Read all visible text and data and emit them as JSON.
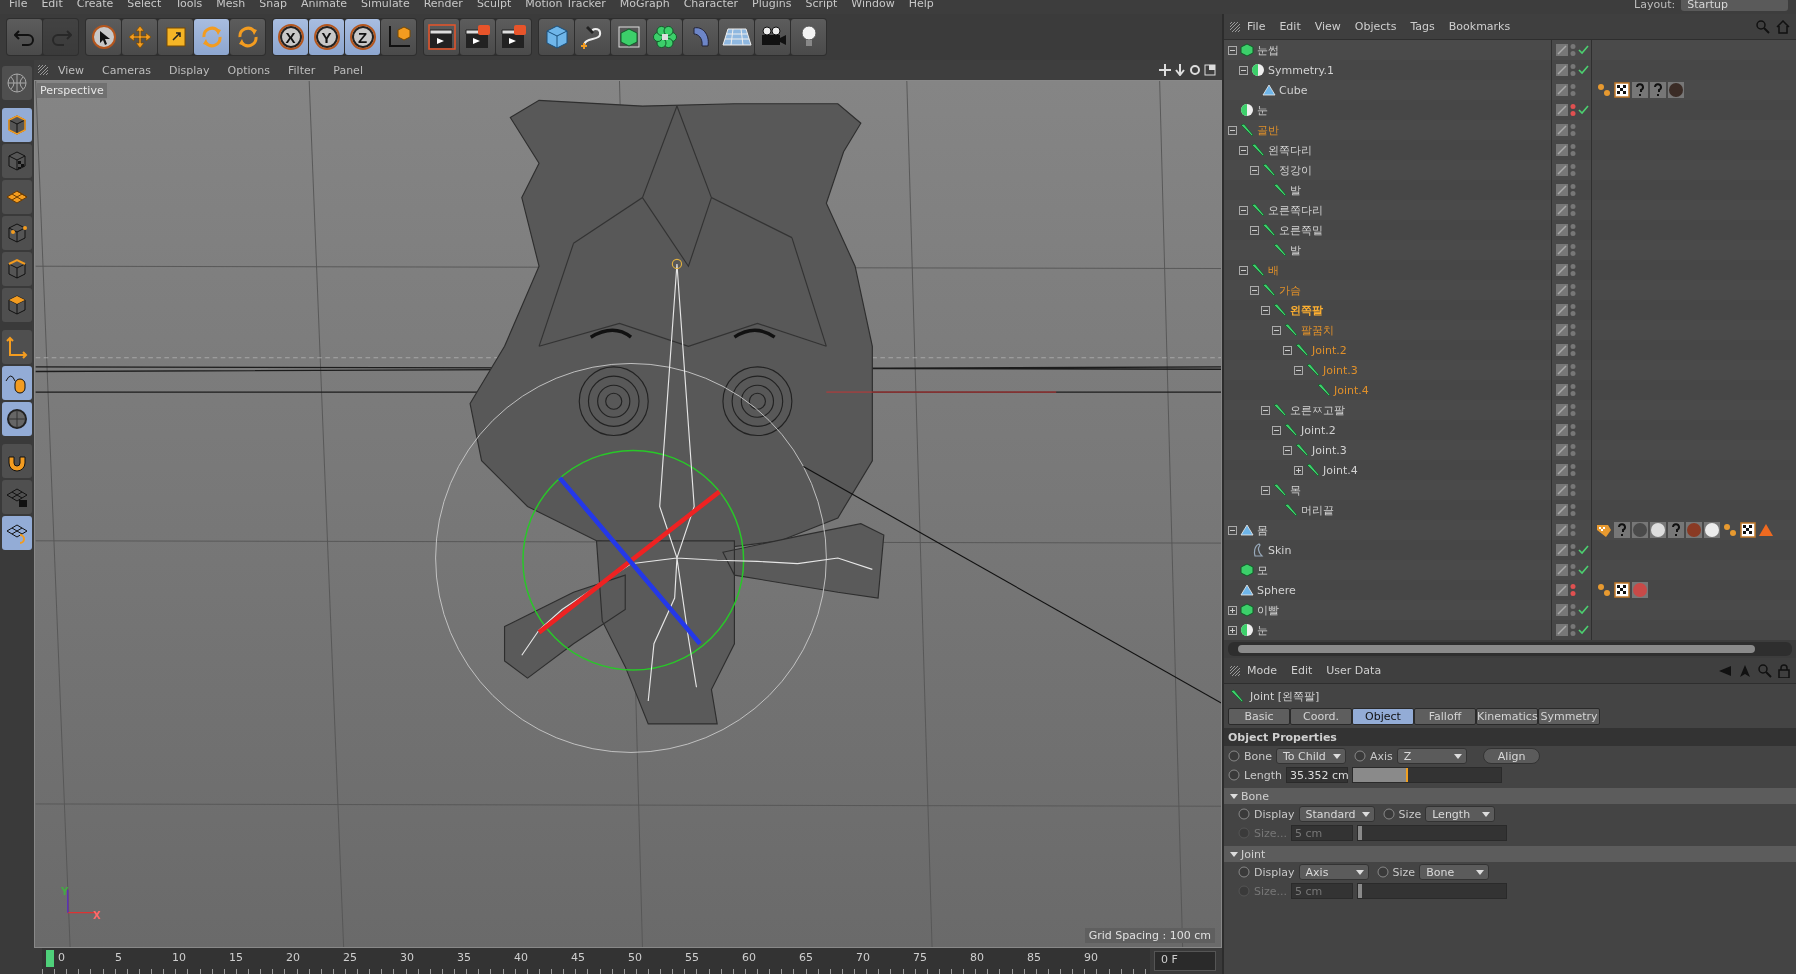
{
  "menu": [
    "File",
    "Edit",
    "Create",
    "Select",
    "Tools",
    "Mesh",
    "Snap",
    "Animate",
    "Simulate",
    "Render",
    "Sculpt",
    "Motion Tracker",
    "MoGraph",
    "Character",
    "Plugins",
    "Script",
    "Window",
    "Help"
  ],
  "layout": {
    "label": "Layout:",
    "value": "Startup"
  },
  "toolbar": [
    [
      {
        "kind": "undo",
        "selected": false,
        "disabled": false
      },
      {
        "kind": "redo",
        "selected": false,
        "disabled": true
      }
    ],
    [
      {
        "kind": "select",
        "selected": false
      },
      {
        "kind": "move",
        "selected": false
      },
      {
        "kind": "scale",
        "selected": false
      },
      {
        "kind": "rotate",
        "selected": true
      },
      {
        "kind": "recent",
        "selected": false
      }
    ],
    [
      {
        "kind": "axis",
        "label": "X",
        "selected": true
      },
      {
        "kind": "axis",
        "label": "Y",
        "selected": true
      },
      {
        "kind": "axis",
        "label": "Z",
        "selected": true
      },
      {
        "kind": "coords",
        "selected": false
      }
    ],
    [
      {
        "kind": "render-view",
        "selected": false
      },
      {
        "kind": "render-picture",
        "selected": false
      },
      {
        "kind": "render-settings",
        "selected": false
      }
    ],
    [
      {
        "kind": "cube",
        "selected": false
      },
      {
        "kind": "pen",
        "selected": false
      },
      {
        "kind": "subdiv",
        "selected": false
      },
      {
        "kind": "array",
        "selected": false
      },
      {
        "kind": "deformer",
        "selected": false
      },
      {
        "kind": "floor",
        "selected": false
      },
      {
        "kind": "camera",
        "selected": false
      },
      {
        "kind": "light",
        "selected": false
      }
    ]
  ],
  "side_tools": [
    {
      "kind": "make-editable",
      "selected": false
    },
    {
      "kind": "model",
      "selected": true
    },
    {
      "kind": "texture",
      "selected": false
    },
    {
      "kind": "workplane",
      "selected": false
    },
    {
      "kind": "points",
      "selected": false
    },
    {
      "kind": "edges",
      "selected": false
    },
    {
      "kind": "polygons",
      "selected": false
    },
    {
      "kind": "axis",
      "selected": false
    },
    {
      "kind": "tweak",
      "selected": true
    },
    {
      "kind": "solo",
      "selected": true
    },
    {
      "kind": "snap",
      "selected": false
    },
    {
      "kind": "lock",
      "selected": false
    },
    {
      "kind": "align",
      "selected": true
    }
  ],
  "viewport": {
    "menu": [
      "View",
      "Cameras",
      "Display",
      "Options",
      "Filter",
      "Panel"
    ],
    "camera": "Perspective",
    "grid_spacing": "Grid Spacing : 100 cm",
    "axis_y": "Y",
    "axis_x": "X"
  },
  "timeline": {
    "ticks": [
      "0",
      "5",
      "10",
      "15",
      "20",
      "25",
      "30",
      "35",
      "40",
      "45",
      "50",
      "55",
      "60",
      "65",
      "70",
      "75",
      "80",
      "85",
      "90"
    ],
    "frame": "0 F"
  },
  "object_manager": {
    "menu": [
      "File",
      "Edit",
      "View",
      "Objects",
      "Tags",
      "Bookmarks"
    ],
    "objects": [
      {
        "name": "눈썹",
        "kind": "null",
        "selected": false,
        "expanded": true,
        "enabled": true,
        "children": [
          {
            "name": "Symmetry.1",
            "kind": "symmetry",
            "selected": false,
            "expanded": true,
            "enabled": true,
            "children": [
              {
                "name": "Cube",
                "kind": "polygon",
                "selected": false,
                "tags": [
                  {
                    "kind": "phong"
                  },
                  {
                    "kind": "checker"
                  },
                  {
                    "kind": "unknown"
                  },
                  {
                    "kind": "unknown"
                  },
                  {
                    "kind": "material",
                    "color": "#3b2c26"
                  }
                ]
              }
            ]
          }
        ]
      },
      {
        "name": "눈",
        "kind": "symmetry",
        "selected": false,
        "hidden": true,
        "enabled": true
      },
      {
        "name": "골반",
        "kind": "joint",
        "selected": false,
        "highlighted": true,
        "expanded": true,
        "children": [
          {
            "name": "왼쪽다리",
            "kind": "joint",
            "selected": false,
            "expanded": true,
            "children": [
              {
                "name": "정강이",
                "kind": "joint",
                "selected": false,
                "expanded": true,
                "children": [
                  {
                    "name": "발",
                    "kind": "joint",
                    "selected": false
                  }
                ]
              }
            ]
          },
          {
            "name": "오른쪽다리",
            "kind": "joint",
            "selected": false,
            "expanded": true,
            "children": [
              {
                "name": "오른쪽밑",
                "kind": "joint",
                "selected": false,
                "expanded": true,
                "children": [
                  {
                    "name": "발",
                    "kind": "joint",
                    "selected": false
                  }
                ]
              }
            ]
          },
          {
            "name": "배",
            "kind": "joint",
            "selected": false,
            "highlighted": true,
            "expanded": true,
            "children": [
              {
                "name": "가슴",
                "kind": "joint",
                "selected": false,
                "highlighted": true,
                "expanded": true,
                "children": [
                  {
                    "name": "왼쪽팔",
                    "kind": "joint",
                    "selected": true,
                    "expanded": true,
                    "children": [
                      {
                        "name": "팔꿈치",
                        "kind": "joint",
                        "selected": false,
                        "highlighted": true,
                        "expanded": true,
                        "children": [
                          {
                            "name": "Joint.2",
                            "kind": "joint",
                            "selected": false,
                            "highlighted": true,
                            "expanded": true,
                            "children": [
                              {
                                "name": "Joint.3",
                                "kind": "joint",
                                "selected": false,
                                "highlighted": true,
                                "expanded": true,
                                "children": [
                                  {
                                    "name": "Joint.4",
                                    "kind": "joint",
                                    "selected": false,
                                    "highlighted": true
                                  }
                                ]
                              }
                            ]
                          }
                        ]
                      }
                    ]
                  },
                  {
                    "name": "오른ㅉ고팔",
                    "kind": "joint",
                    "selected": false,
                    "expanded": true,
                    "children": [
                      {
                        "name": "Joint.2",
                        "kind": "joint",
                        "selected": false,
                        "expanded": true,
                        "children": [
                          {
                            "name": "Joint.3",
                            "kind": "joint",
                            "selected": false,
                            "expanded": true,
                            "children": [
                              {
                                "name": "Joint.4",
                                "kind": "joint",
                                "selected": false,
                                "expanded": false
                              }
                            ]
                          }
                        ]
                      }
                    ]
                  },
                  {
                    "name": "목",
                    "kind": "joint",
                    "selected": false,
                    "expanded": true,
                    "children": [
                      {
                        "name": "머리끝",
                        "kind": "joint",
                        "selected": false
                      }
                    ]
                  }
                ]
              }
            ]
          }
        ]
      },
      {
        "name": "몸",
        "kind": "polygon",
        "selected": false,
        "expanded": true,
        "tags": [
          {
            "kind": "weight"
          },
          {
            "kind": "unknown"
          },
          {
            "kind": "material",
            "color": "#4a4a4a"
          },
          {
            "kind": "material",
            "color": "#dedede"
          },
          {
            "kind": "unknown"
          },
          {
            "kind": "material",
            "color": "#8a3a24"
          },
          {
            "kind": "material",
            "color": "#ececec"
          },
          {
            "kind": "phong"
          },
          {
            "kind": "checker"
          },
          {
            "kind": "selection"
          }
        ],
        "children": [
          {
            "name": "Skin",
            "kind": "skin",
            "selected": false,
            "enabled": true
          }
        ]
      },
      {
        "name": "모",
        "kind": "null",
        "selected": false,
        "enabled": true
      },
      {
        "name": "Sphere",
        "kind": "polygon",
        "selected": false,
        "hidden": true,
        "tags": [
          {
            "kind": "phong"
          },
          {
            "kind": "checker"
          },
          {
            "kind": "material",
            "color": "#c84a48"
          }
        ]
      },
      {
        "name": "이빨",
        "kind": "null",
        "selected": false,
        "expanded": false,
        "enabled": true
      },
      {
        "name": "눈",
        "kind": "symmetry",
        "selected": false,
        "expanded": false,
        "enabled": true
      }
    ]
  },
  "attributes": {
    "menu": [
      "Mode",
      "Edit",
      "User Data"
    ],
    "title": "Joint [왼쪽팔]",
    "tabs": [
      {
        "label": "Basic",
        "selected": false
      },
      {
        "label": "Coord.",
        "selected": false
      },
      {
        "label": "Object",
        "selected": true
      },
      {
        "label": "Falloff",
        "selected": false
      },
      {
        "label": "Kinematics",
        "selected": false
      },
      {
        "label": "Symmetry",
        "selected": false
      }
    ],
    "section": "Object Properties",
    "rows": [
      [
        {
          "kind": "dropdown",
          "label": "Bone",
          "value": "To Child",
          "animated": false
        },
        {
          "kind": "dropdown",
          "label": "Axis",
          "value": "Z",
          "animated": false
        },
        {
          "kind": "button",
          "label": "Align"
        }
      ],
      [
        {
          "kind": "slider",
          "label": "Length",
          "value": "35.352 cm",
          "level": 0.37,
          "disabled": false,
          "animated": false
        }
      ]
    ],
    "groups": [
      {
        "title": "Bone",
        "expanded": true,
        "rows": [
          [
            {
              "kind": "dropdown",
              "label": "Display",
              "value": "Standard",
              "animated": false
            },
            {
              "kind": "dropdown",
              "label": "Size",
              "value": "Length",
              "animated": false
            }
          ],
          [
            {
              "kind": "slider",
              "label": "Size...",
              "value": "5 cm",
              "level": 0.02,
              "disabled": true,
              "animated": false
            }
          ]
        ]
      },
      {
        "title": "Joint",
        "expanded": true,
        "rows": [
          [
            {
              "kind": "dropdown",
              "label": "Display",
              "value": "Axis",
              "animated": false
            },
            {
              "kind": "dropdown",
              "label": "Size",
              "value": "Bone",
              "animated": false
            }
          ],
          [
            {
              "kind": "slider",
              "label": "Size...",
              "value": "5 cm",
              "level": 0.02,
              "disabled": true,
              "animated": false
            }
          ]
        ]
      }
    ]
  }
}
